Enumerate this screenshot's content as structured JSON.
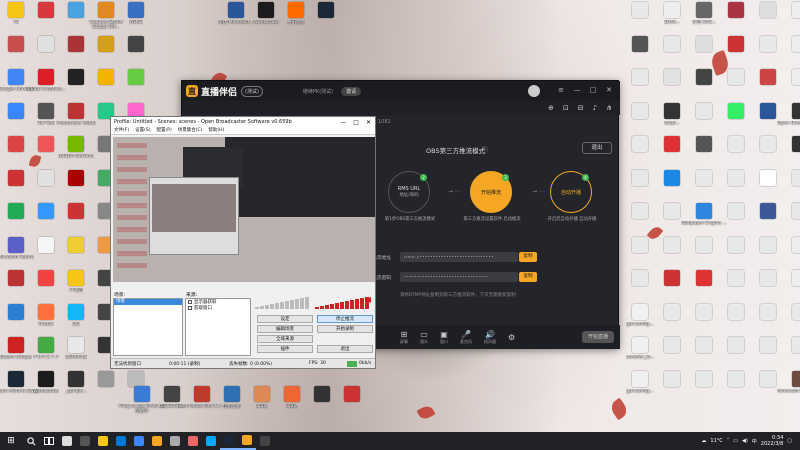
{
  "desktop": {
    "icons": [
      {
        "label": "72",
        "color": "#f5c518"
      },
      {
        "label": "",
        "color": "#d63a3a"
      },
      {
        "label": "",
        "color": "#4aa3df"
      },
      {
        "label": "Counter-Strike Global Off...",
        "color": "#e08a1e"
      },
      {
        "label": "WDSS",
        "color": "#3b6fc2"
      },
      {
        "label": "",
        "color": "#c94f4f"
      },
      {
        "label": "",
        "color": "#e0e0e0"
      },
      {
        "label": "",
        "color": "#a33"
      },
      {
        "label": "",
        "color": "#d4a017"
      },
      {
        "label": "",
        "color": "#444"
      },
      {
        "label": "Google Chrome",
        "color": "#4285f4"
      },
      {
        "label": "Adobe Creative...",
        "color": "#da1f26"
      },
      {
        "label": "",
        "color": "#222"
      },
      {
        "label": "",
        "color": "#f2b400"
      },
      {
        "label": "",
        "color": "#6c4"
      },
      {
        "label": "",
        "color": "#3a86ff"
      },
      {
        "label": "Full Tear",
        "color": "#555"
      },
      {
        "label": "Prestonese Yelbur",
        "color": "#b33"
      },
      {
        "label": "",
        "color": "#2c8"
      },
      {
        "label": "",
        "color": "#f6c"
      },
      {
        "label": "",
        "color": "#d44"
      },
      {
        "label": "",
        "color": "#e55"
      },
      {
        "label": "NVIDIA GeForce",
        "color": "#76b900"
      },
      {
        "label": "",
        "color": "#777"
      },
      {
        "label": "",
        "color": "#333"
      },
      {
        "label": "",
        "color": "#c33"
      },
      {
        "label": "",
        "color": "#e0e0e0"
      },
      {
        "label": "",
        "color": "#a00"
      },
      {
        "label": "",
        "color": "#4a6"
      },
      {
        "label": "",
        "color": "#555"
      },
      {
        "label": "",
        "color": "#2a5"
      },
      {
        "label": "",
        "color": "#39f"
      },
      {
        "label": "",
        "color": "#c33"
      },
      {
        "label": "",
        "color": "#888"
      },
      {
        "label": "",
        "color": "#ddd"
      },
      {
        "label": "Microsoft Teams",
        "color": "#5b5fc7"
      },
      {
        "label": "",
        "color": "#f5f5f5"
      },
      {
        "label": "",
        "color": "#ec3"
      },
      {
        "label": "",
        "color": "#e94"
      },
      {
        "label": "",
        "color": "#555"
      },
      {
        "label": "",
        "color": "#b33"
      },
      {
        "label": "",
        "color": "#e44"
      },
      {
        "label": "YY语音",
        "color": "#f5c518"
      },
      {
        "label": "",
        "color": "#444"
      },
      {
        "label": "",
        "color": "#d5d5d5"
      },
      {
        "label": "",
        "color": "#2d7dd2"
      },
      {
        "label": "Firefox",
        "color": "#ff7139"
      },
      {
        "label": "QQ",
        "color": "#12b7f5"
      },
      {
        "label": "",
        "color": "#444"
      },
      {
        "label": "",
        "color": "#eee"
      },
      {
        "label": "Steam Unique",
        "color": "#c22"
      },
      {
        "label": "P O P 2 7 7",
        "color": "#4a4"
      },
      {
        "label": "100APPLE",
        "color": "#e8e8e8"
      },
      {
        "label": "",
        "color": "#333"
      },
      {
        "label": "",
        "color": "#c44"
      },
      {
        "label": "Steam Mind & Sway",
        "color": "#1b2838"
      },
      {
        "label": "Windscribe",
        "color": "#1c1c1c"
      },
      {
        "label": "_cpi-bin...",
        "color": "#333"
      },
      {
        "label": "",
        "color": "#999"
      },
      {
        "label": "",
        "color": "#bbb"
      }
    ],
    "mid_icons": [
      {
        "label": "新建 Microsoft...",
        "color": "#2b579a"
      },
      {
        "label": "Windscribe",
        "color": "#1c1c1c"
      },
      {
        "label": "腾讯视频",
        "color": "#ff6a00"
      },
      {
        "label": "",
        "color": "#1b2838"
      }
    ],
    "right_icons": [
      {
        "label": "",
        "color": "#e8e8e8"
      },
      {
        "label": "SDKe...",
        "color": "#eee"
      },
      {
        "label": "打包 SNS...",
        "color": "#666"
      },
      {
        "label": "",
        "color": "#a34"
      },
      {
        "label": "",
        "color": "#ddd"
      },
      {
        "label": "",
        "color": "#eee"
      },
      {
        "label": "",
        "color": "#555"
      },
      {
        "label": "",
        "color": "#e8e8e8"
      },
      {
        "label": "",
        "color": "#ddd"
      },
      {
        "label": "",
        "color": "#c33"
      },
      {
        "label": "",
        "color": "#e8e8e8"
      },
      {
        "label": "",
        "color": "#eee"
      },
      {
        "label": "",
        "color": "#e8e8e8"
      },
      {
        "label": "",
        "color": "#e2e2e2"
      },
      {
        "label": "",
        "color": "#444"
      },
      {
        "label": "",
        "color": "#e8e8e8"
      },
      {
        "label": "",
        "color": "#c44"
      },
      {
        "label": "",
        "color": "#eee"
      },
      {
        "label": "",
        "color": "#e8e8e8"
      },
      {
        "label": "obspi...",
        "color": "#333"
      },
      {
        "label": "",
        "color": "#e8e8e8"
      },
      {
        "label": "",
        "color": "#3e6"
      },
      {
        "label": "",
        "color": "#2b579a"
      },
      {
        "label": "Open Broadcaster...",
        "color": "#333"
      },
      {
        "label": "",
        "color": "#e8e8e8"
      },
      {
        "label": "",
        "color": "#d33"
      },
      {
        "label": "",
        "color": "#555"
      },
      {
        "label": "",
        "color": "#e8e8e8"
      },
      {
        "label": "",
        "color": "#e8e8e8"
      },
      {
        "label": "",
        "color": "#333"
      },
      {
        "label": "",
        "color": "#e8e8e8"
      },
      {
        "label": "",
        "color": "#1e88e5"
      },
      {
        "label": "",
        "color": "#e8e8e8"
      },
      {
        "label": "",
        "color": "#e8e8e8"
      },
      {
        "label": "",
        "color": "#fff"
      },
      {
        "label": "",
        "color": "#e8e8e8"
      },
      {
        "label": "",
        "color": "#e8e8e8"
      },
      {
        "label": "",
        "color": "#e8e8e8"
      },
      {
        "label": "Wallpaper Engine ...",
        "color": "#2e86de"
      },
      {
        "label": "",
        "color": "#e8e8e8"
      },
      {
        "label": "",
        "color": "#3b5998"
      },
      {
        "label": "",
        "color": "#e8e8e8"
      },
      {
        "label": "",
        "color": "#e8e8e8"
      },
      {
        "label": "",
        "color": "#e8e8e8"
      },
      {
        "label": "",
        "color": "#e8e8e8"
      },
      {
        "label": "",
        "color": "#e8e8e8"
      },
      {
        "label": "",
        "color": "#e8e8e8"
      },
      {
        "label": "",
        "color": "#eee"
      },
      {
        "label": "",
        "color": "#e8e8e8"
      },
      {
        "label": "",
        "color": "#c33"
      },
      {
        "label": "",
        "color": "#d33"
      },
      {
        "label": "",
        "color": "#e8e8e8"
      },
      {
        "label": "",
        "color": "#e8e8e8"
      },
      {
        "label": "",
        "color": "#eee"
      },
      {
        "label": "gui-config...",
        "color": "#f0f0f0"
      },
      {
        "label": "",
        "color": "#e8e8e8"
      },
      {
        "label": "",
        "color": "#e8e8e8"
      },
      {
        "label": "",
        "color": "#e8e8e8"
      },
      {
        "label": "",
        "color": "#e8e8e8"
      },
      {
        "label": "",
        "color": "#e8e8e8"
      },
      {
        "label": "transfer_lo...",
        "color": "#f0f0f0"
      },
      {
        "label": "",
        "color": "#e8e8e8"
      },
      {
        "label": "",
        "color": "#e8e8e8"
      },
      {
        "label": "",
        "color": "#e8e8e8"
      },
      {
        "label": "",
        "color": "#e8e8e8"
      },
      {
        "label": "",
        "color": "#e8e8e8"
      },
      {
        "label": "gui-config...",
        "color": "#f0f0f0"
      },
      {
        "label": "",
        "color": "#e8e8e8"
      },
      {
        "label": "",
        "color": "#e8e8e8"
      },
      {
        "label": "",
        "color": "#e8e8e8"
      },
      {
        "label": "",
        "color": "#e8e8e8"
      },
      {
        "label": "Minecraft Dungeons",
        "color": "#6d4c41"
      }
    ],
    "bottom_icons": [
      {
        "label": "Fling to the Finish 原创战斗",
        "color": "#3a7bd5"
      },
      {
        "label": "ks153635...",
        "color": "#444"
      },
      {
        "label": "Red Panda Dev C++",
        "color": "#c0392b"
      },
      {
        "label": "控制面板",
        "color": "#2f6fb3"
      },
      {
        "label": "第3期",
        "color": "#d85"
      },
      {
        "label": "第3期",
        "color": "#e63"
      },
      {
        "label": "",
        "color": "#333"
      },
      {
        "label": "",
        "color": "#c33"
      }
    ]
  },
  "app": {
    "logo": "直",
    "title": "直播伴侣",
    "version": "(测试)",
    "status_text": "继续PK(测试)",
    "extra_label": "邀请",
    "toolbar_text": "1081",
    "mode_title": "OBS第三方推流模式",
    "help_icon": "ⓘ",
    "exit_label": "退出",
    "steps": [
      {
        "line1": "RMS URL",
        "line2": "地址/串码",
        "num": "2",
        "desc": "第1步OBS第三方推流模式"
      },
      {
        "line1": "开始推流",
        "line2": "",
        "num": "3",
        "desc": "第三方推流设置软件 启动推流"
      },
      {
        "line1": "自动开播",
        "line2": "",
        "num": "4",
        "desc": "开启后自动开播 自动开播"
      }
    ],
    "url_label": "推流地址",
    "url_value": "rtmp://••••••••••••••••••••••••••••",
    "key_label": "推流密码",
    "key_value": "••••••••••••••••••••••••••••••••",
    "copy_label": "复制",
    "tip": "请将RTMP地址复制到第三方推流软件。下次无需重新复制",
    "bottom_items": [
      {
        "glyph": "⊞",
        "label": "屏幕"
      },
      {
        "glyph": "▭",
        "label": "镜头"
      },
      {
        "glyph": "▣",
        "label": "窗口"
      },
      {
        "glyph": "🎤",
        "label": "麦克风"
      },
      {
        "glyph": "🔊",
        "label": "扬声器"
      },
      {
        "glyph": "⚙",
        "label": ""
      }
    ],
    "start_live_label": "开始直播"
  },
  "obs": {
    "title": "Profile: Untitled - Scenes: scenes - Open Broadcaster Software v0.659b",
    "menu": [
      "文件(F)",
      "设置(S)",
      "配置(P)",
      "场景集合(C)",
      "帮助(H)"
    ],
    "scenes_label": "场景:",
    "sources_label": "来源:",
    "scene_selected": "场景",
    "sources": [
      "显示器获取",
      "获取窗口"
    ],
    "buttons": [
      "设定",
      "停止推流",
      "编辑场景",
      "开始录制",
      "全域来源",
      "插件",
      "退出"
    ],
    "status": {
      "window": "无法找到窗口",
      "time": "0:00:11 (录制)",
      "dropped": "丢失帧数: 0 (0.00%)",
      "fps": "FPS: 30",
      "kbps": "0kb/s"
    }
  },
  "taskbar": {
    "start_glyph": "⊞",
    "apps": [
      {
        "color": "#ddd"
      },
      {
        "color": "#555"
      },
      {
        "color": "#f5c518"
      },
      {
        "color": "#0078d4"
      },
      {
        "color": "#3a86ff"
      },
      {
        "color": "#f5a623"
      },
      {
        "color": "#aaa"
      },
      {
        "color": "#e66"
      },
      {
        "color": "#0af"
      },
      {
        "color": "#1b2838"
      },
      {
        "color": "#f5a623"
      },
      {
        "color": "#444"
      }
    ],
    "weather": "11°C",
    "ime": "中",
    "time": "0:34",
    "date": "2022/3/8"
  }
}
